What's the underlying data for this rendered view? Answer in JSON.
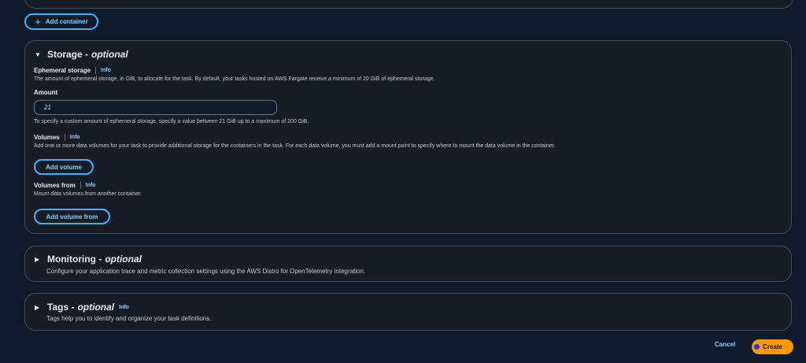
{
  "add_container": {
    "icon": "plus-icon",
    "label": "Add container"
  },
  "storage": {
    "title": "Storage - ",
    "optional": "optional",
    "ephemeral": {
      "label": "Ephemeral storage",
      "info": "Info",
      "description": "The amount of ephemeral storage, in GiB, to allocate for the task. By default, your tasks hosted on AWS Fargate receive a minimum of 20 GiB of ephemeral storage."
    },
    "amount": {
      "label": "Amount",
      "value": "21",
      "hint": "To specify a custom amount of ephemeral storage, specify a value between 21 GiB up to a maximum of 200 GiB."
    },
    "volumes": {
      "label": "Volumes",
      "info": "Info",
      "description": "Add one or more data volumes for your task to provide additional storage for the containers in the task. For each data volume, you must add a mount point to specify where to mount the data volume in the container.",
      "button": "Add volume"
    },
    "volumes_from": {
      "label": "Volumes from",
      "info": "Info",
      "description": "Mount data volumes from another container.",
      "button": "Add volume from"
    }
  },
  "monitoring": {
    "title": "Monitoring - ",
    "optional": "optional",
    "description": "Configure your application trace and metric collection settings using the AWS Distro for OpenTelemetry integration."
  },
  "tags": {
    "title": "Tags - ",
    "optional": "optional",
    "info": "Info",
    "description": "Tags help you to identify and organize your task definitions."
  },
  "footer": {
    "cancel": "Cancel",
    "create": "Create"
  },
  "colors": {
    "accent": "#42b4ff",
    "primary_button": "#ff9900",
    "background": "#0f1b2a",
    "panel": "#161d26"
  }
}
